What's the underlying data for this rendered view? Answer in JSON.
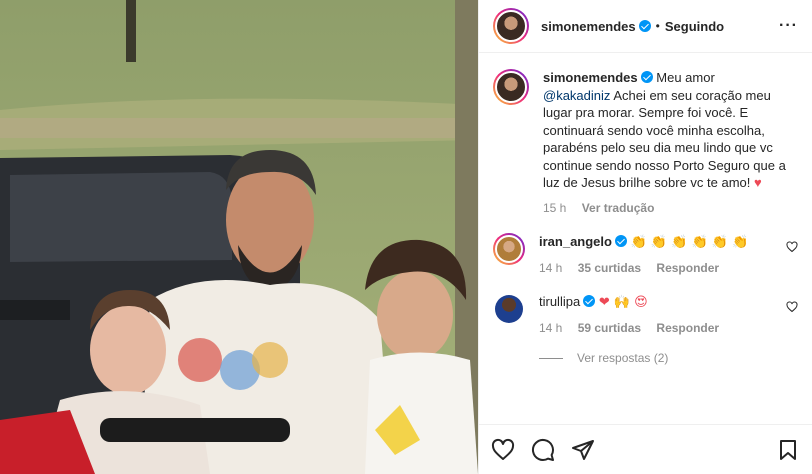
{
  "post": {
    "username": "simonemendes",
    "follow_status": "Seguindo",
    "caption_mention": "@kakadiniz",
    "caption_pre": "Meu amor",
    "caption_text": "Achei em seu coração meu lugar pra morar. Sempre foi você. E continuará sendo você minha escolha, parabéns pelo seu dia meu lindo que vc continue sendo nosso Porto Seguro que a luz de Jesus brilhe sobre vc te amo!",
    "caption_emoji": "♥",
    "caption_time": "15 h",
    "translate_label": "Ver tradução"
  },
  "comments": [
    {
      "username": "iran_angelo",
      "text": "👏 👏 👏 👏 👏 👏",
      "time": "14 h",
      "likes": "35 curtidas",
      "reply": "Responder"
    },
    {
      "username": "tirullipa",
      "text": "❤ 🙌 😍",
      "time": "14 h",
      "likes": "59 curtidas",
      "reply": "Responder"
    }
  ],
  "view_replies": "Ver respostas (2)",
  "colors": {
    "verified": "#0095f6",
    "heart": "#ed4956",
    "text": "#262626",
    "muted": "#8e8e8e"
  },
  "icons": [
    "heart-icon",
    "comment-icon",
    "share-icon",
    "save-icon",
    "more-icon",
    "verified-icon"
  ]
}
